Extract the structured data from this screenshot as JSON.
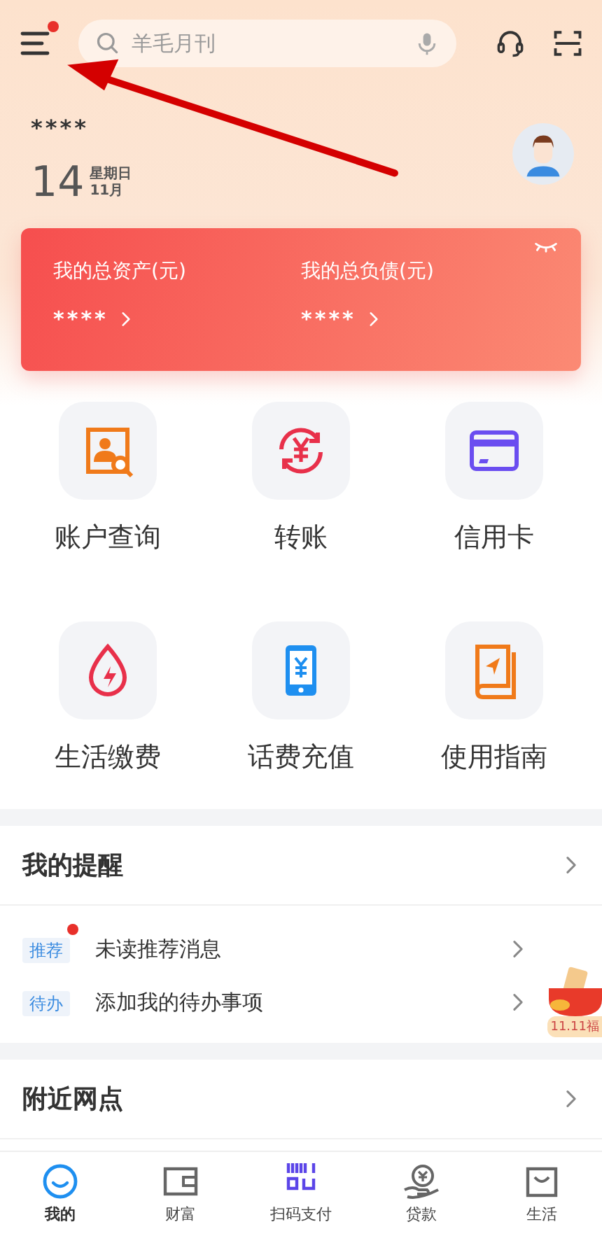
{
  "header": {
    "menu_badge": true,
    "search": {
      "placeholder": "羊毛月刊"
    }
  },
  "user": {
    "name": "****",
    "day": "14",
    "weekday": "星期日",
    "month": "11月"
  },
  "assets": [
    {
      "label": "我的总资产(元)",
      "value": "****"
    },
    {
      "label": "我的总负债(元)",
      "value": "****"
    }
  ],
  "shortcuts": [
    {
      "label": "账户查询",
      "kind": "account"
    },
    {
      "label": "转账",
      "kind": "transfer"
    },
    {
      "label": "信用卡",
      "kind": "card"
    },
    {
      "label": "生活缴费",
      "kind": "utility"
    },
    {
      "label": "话费充值",
      "kind": "phone"
    },
    {
      "label": "使用指南",
      "kind": "guide"
    }
  ],
  "reminders": {
    "title": "我的提醒",
    "items": [
      {
        "tag": "推荐",
        "text": "未读推荐消息",
        "unread": true
      },
      {
        "tag": "待办",
        "text": "添加我的待办事项",
        "unread": false
      }
    ]
  },
  "nearby": {
    "title": "附近网点"
  },
  "promo_badge": "11.11福",
  "nav": [
    {
      "label": "我的",
      "kind": "me",
      "selected": true
    },
    {
      "label": "财富",
      "kind": "wallet",
      "selected": false
    },
    {
      "label": "扫码支付",
      "kind": "scan",
      "selected": false
    },
    {
      "label": "贷款",
      "kind": "loan",
      "selected": false
    },
    {
      "label": "生活",
      "kind": "life",
      "selected": false
    }
  ]
}
